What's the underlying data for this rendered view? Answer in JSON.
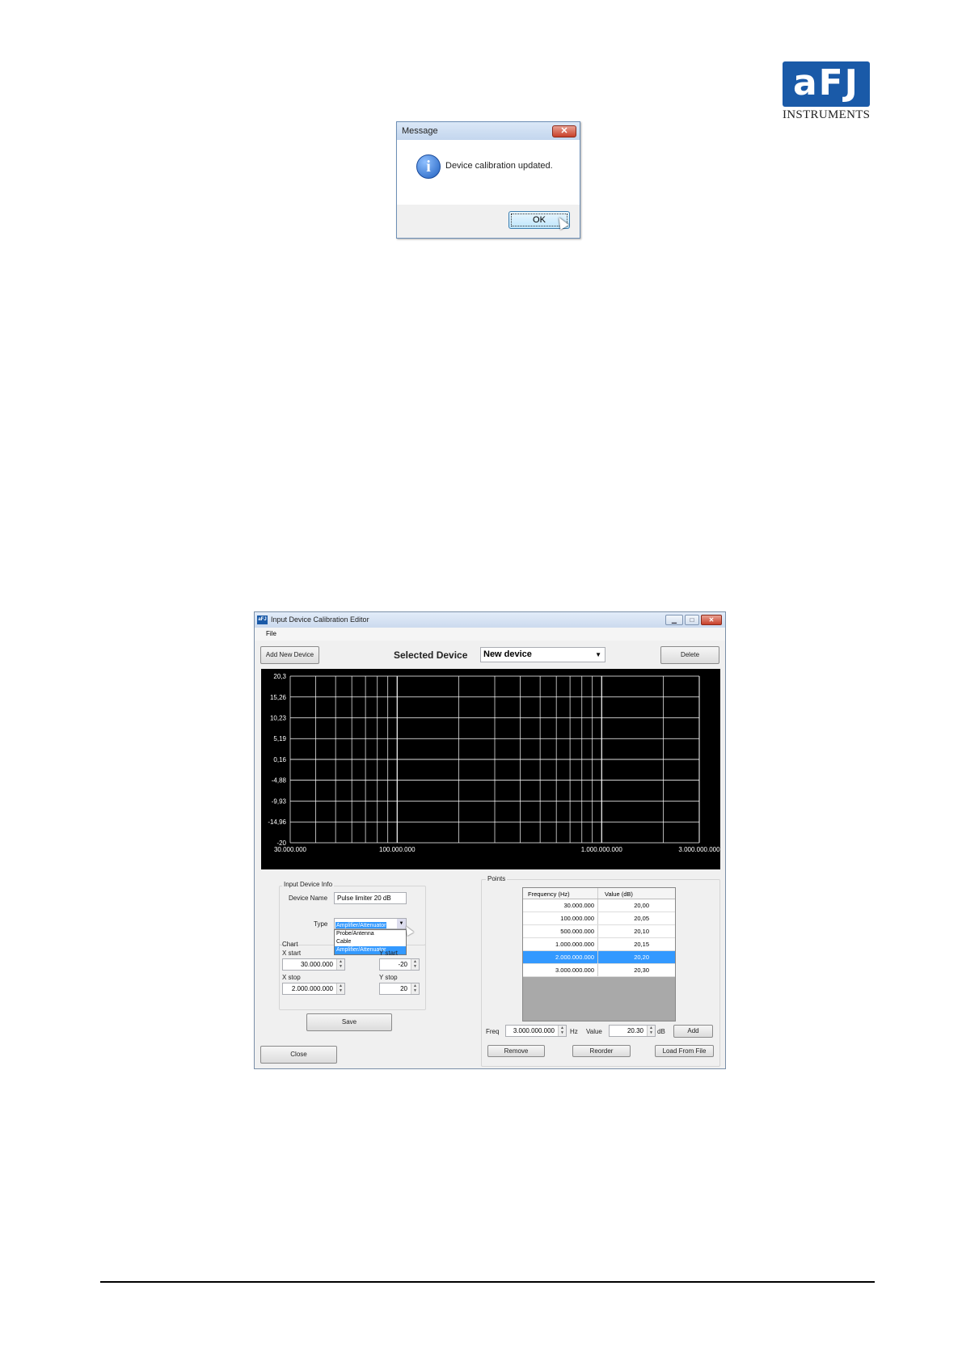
{
  "logo": {
    "mark": "aFJ",
    "text": "INSTRUMENTS"
  },
  "message_dialog": {
    "title": "Message",
    "close": "✕",
    "icon": "info-icon",
    "text": "Device calibration updated.",
    "ok_label": "OK"
  },
  "editor": {
    "title": "Input Device Calibration Editor",
    "menu": [
      "File"
    ],
    "add_new_device": "Add New Device",
    "selected_device_label": "Selected Device",
    "selected_device_value": "New device",
    "delete_label": "Delete",
    "info_group": "Input Device Info",
    "device_name_label": "Device Name",
    "device_name_value": "Pulse limiter 20 dB",
    "type_label": "Type",
    "type_value": "Amplifier/Attenuator",
    "type_options": [
      "Probe/Antenna",
      "Cable",
      "Amplifier/Attenuator"
    ],
    "chart_group": "Chart",
    "x_start_label": "X start",
    "x_start_value": "30.000.000",
    "y_start_label": "Y start",
    "y_start_value": "-20",
    "x_stop_label": "X stop",
    "x_stop_value": "2.000.000.000",
    "y_stop_label": "Y stop",
    "y_stop_value": "20",
    "save_label": "Save",
    "close_label": "Close",
    "points_group": "Points",
    "table": {
      "headers": [
        "Frequency (Hz)",
        "Value (dB)"
      ],
      "rows": [
        [
          "30.000.000",
          "20,00"
        ],
        [
          "100.000.000",
          "20,05"
        ],
        [
          "500.000.000",
          "20,10"
        ],
        [
          "1.000.000.000",
          "20,15"
        ],
        [
          "2.000.000.000",
          "20,20"
        ],
        [
          "3.000.000.000",
          "20,30"
        ]
      ],
      "selected_row": 4
    },
    "freq_label": "Freq",
    "freq_value": "3.000.000.000",
    "hz_label": "Hz",
    "value_label": "Value",
    "value_value": "20.30",
    "db_label": "dB",
    "add_label": "Add",
    "remove_label": "Remove",
    "reorder_label": "Reorder",
    "load_label": "Load From File"
  },
  "chart_data": {
    "type": "line",
    "x_scale": "log",
    "xlim": [
      30000000,
      3000000000
    ],
    "ylim": [
      -20,
      20.3
    ],
    "x_tick_labels": [
      "30.000.000",
      "100.000.000",
      "1.000.000.000",
      "3.000.000.000"
    ],
    "x_tick_values": [
      30000000,
      100000000,
      1000000000,
      3000000000
    ],
    "y_tick_labels": [
      "20,3",
      "15,26",
      "10,23",
      "5,19",
      "0,16",
      "-4,88",
      "-9,93",
      "-14,96",
      "-20"
    ],
    "y_tick_values": [
      20.3,
      15.26,
      10.23,
      5.19,
      0.16,
      -4.88,
      -9.93,
      -14.96,
      -20
    ],
    "grid": true,
    "background": "#000000",
    "grid_color": "#ffffff",
    "series": []
  }
}
